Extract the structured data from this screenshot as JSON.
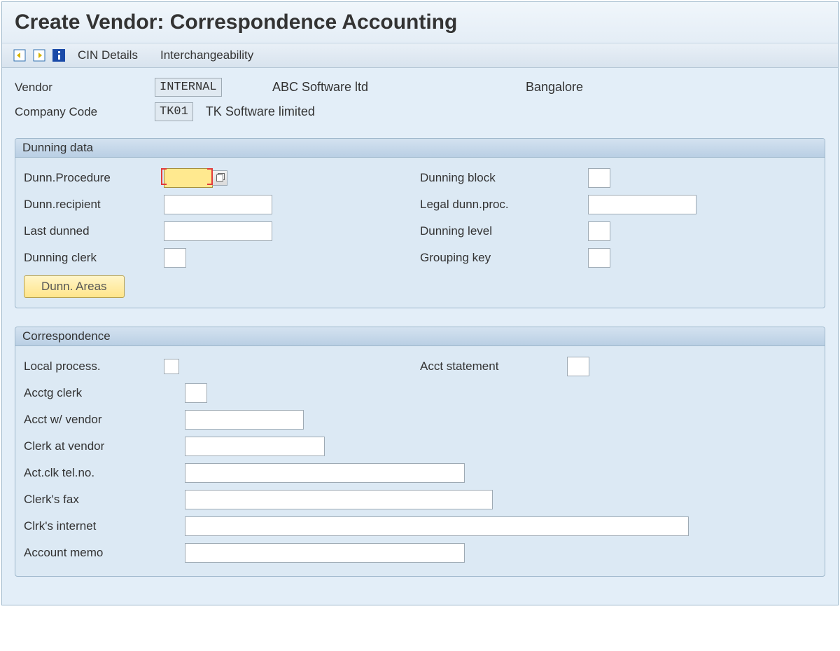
{
  "title": "Create Vendor: Correspondence Accounting",
  "toolbar": {
    "cin_details": "CIN Details",
    "interchangeability": "Interchangeability"
  },
  "header": {
    "vendor_label": "Vendor",
    "vendor_value": "INTERNAL",
    "vendor_name": "ABC Software ltd",
    "vendor_city": "Bangalore",
    "company_label": "Company Code",
    "company_value": "TK01",
    "company_name": "TK Software limited"
  },
  "dunning": {
    "title": "Dunning data",
    "procedure_label": "Dunn.Procedure",
    "procedure_value": "",
    "block_label": "Dunning block",
    "block_value": "",
    "recipient_label": "Dunn.recipient",
    "recipient_value": "",
    "legal_label": "Legal dunn.proc.",
    "legal_value": "",
    "last_dunned_label": "Last dunned",
    "last_dunned_value": "",
    "level_label": "Dunning level",
    "level_value": "",
    "clerk_label": "Dunning clerk",
    "clerk_value": "",
    "grouping_label": "Grouping key",
    "grouping_value": "",
    "areas_button": "Dunn. Areas"
  },
  "corr": {
    "title": "Correspondence",
    "local_process_label": "Local process.",
    "acct_statement_label": "Acct statement",
    "acct_statement_value": "",
    "acctg_clerk_label": "Acctg clerk",
    "acctg_clerk_value": "",
    "acct_vendor_label": "Acct w/ vendor",
    "acct_vendor_value": "",
    "clerk_vendor_label": "Clerk at vendor",
    "clerk_vendor_value": "",
    "clerk_tel_label": "Act.clk tel.no.",
    "clerk_tel_value": "",
    "clerk_fax_label": "Clerk's fax",
    "clerk_fax_value": "",
    "clerk_internet_label": "Clrk's internet",
    "clerk_internet_value": "",
    "memo_label": "Account memo",
    "memo_value": ""
  }
}
